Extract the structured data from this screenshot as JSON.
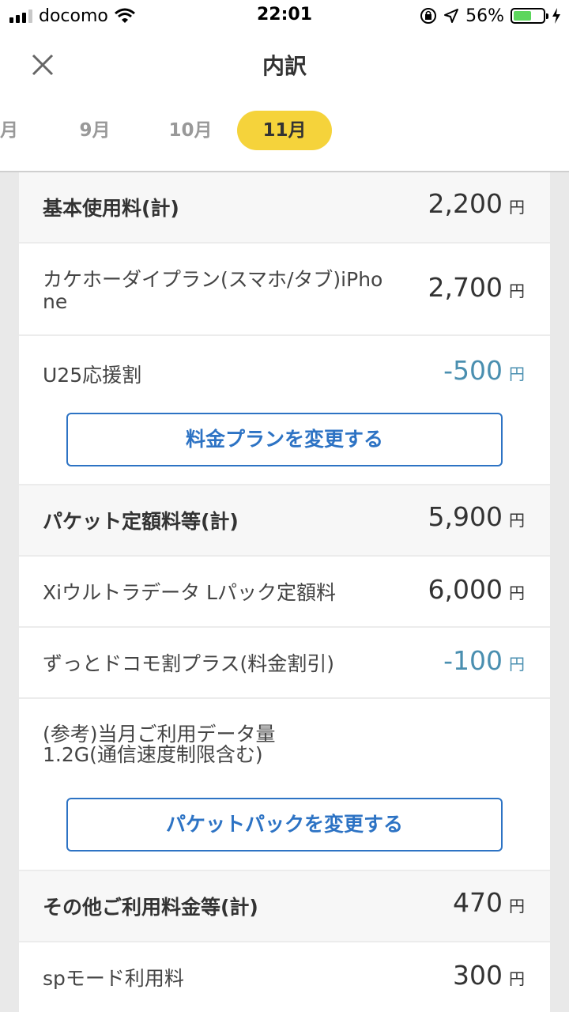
{
  "status_bar": {
    "carrier": "docomo",
    "time": "22:01",
    "battery_percent": "56%",
    "battery_level": 0.56
  },
  "header": {
    "title": "内訳",
    "tabs": [
      {
        "label": "月",
        "active": false
      },
      {
        "label": "9月",
        "active": false
      },
      {
        "label": "10月",
        "active": false
      },
      {
        "label": "11月",
        "active": true
      }
    ]
  },
  "sections": {
    "basic": {
      "total_label": "基本使用料(計)",
      "total_amount": "2,200",
      "items": [
        {
          "label_line1": "カケホーダイプラン(スマホ/タブ)iPho",
          "label_line2": "ne",
          "amount": "2,700"
        },
        {
          "label": "U25応援割",
          "amount": "-500"
        }
      ],
      "button_label": "料金プランを変更する"
    },
    "packet": {
      "total_label": "パケット定額料等(計)",
      "total_amount": "5,900",
      "items": [
        {
          "label": "Xiウルトラデータ Lパック定額料",
          "amount": "6,000"
        },
        {
          "label": "ずっとドコモ割プラス(料金割引)",
          "amount": "-100"
        }
      ],
      "note_line1": "(参考)当月ご利用データ量",
      "note_line2": "1.2G(通信速度制限含む)",
      "button_label": "パケットパックを変更する"
    },
    "other": {
      "total_label": "その他ご利用料金等(計)",
      "total_amount": "470",
      "items": [
        {
          "label": "spモード利用料",
          "amount": "300"
        }
      ]
    }
  },
  "currency": "円",
  "colors": {
    "accent_tab": "#f5d33b",
    "button_blue": "#2d73c4",
    "discount_text": "#4a8fb0"
  }
}
